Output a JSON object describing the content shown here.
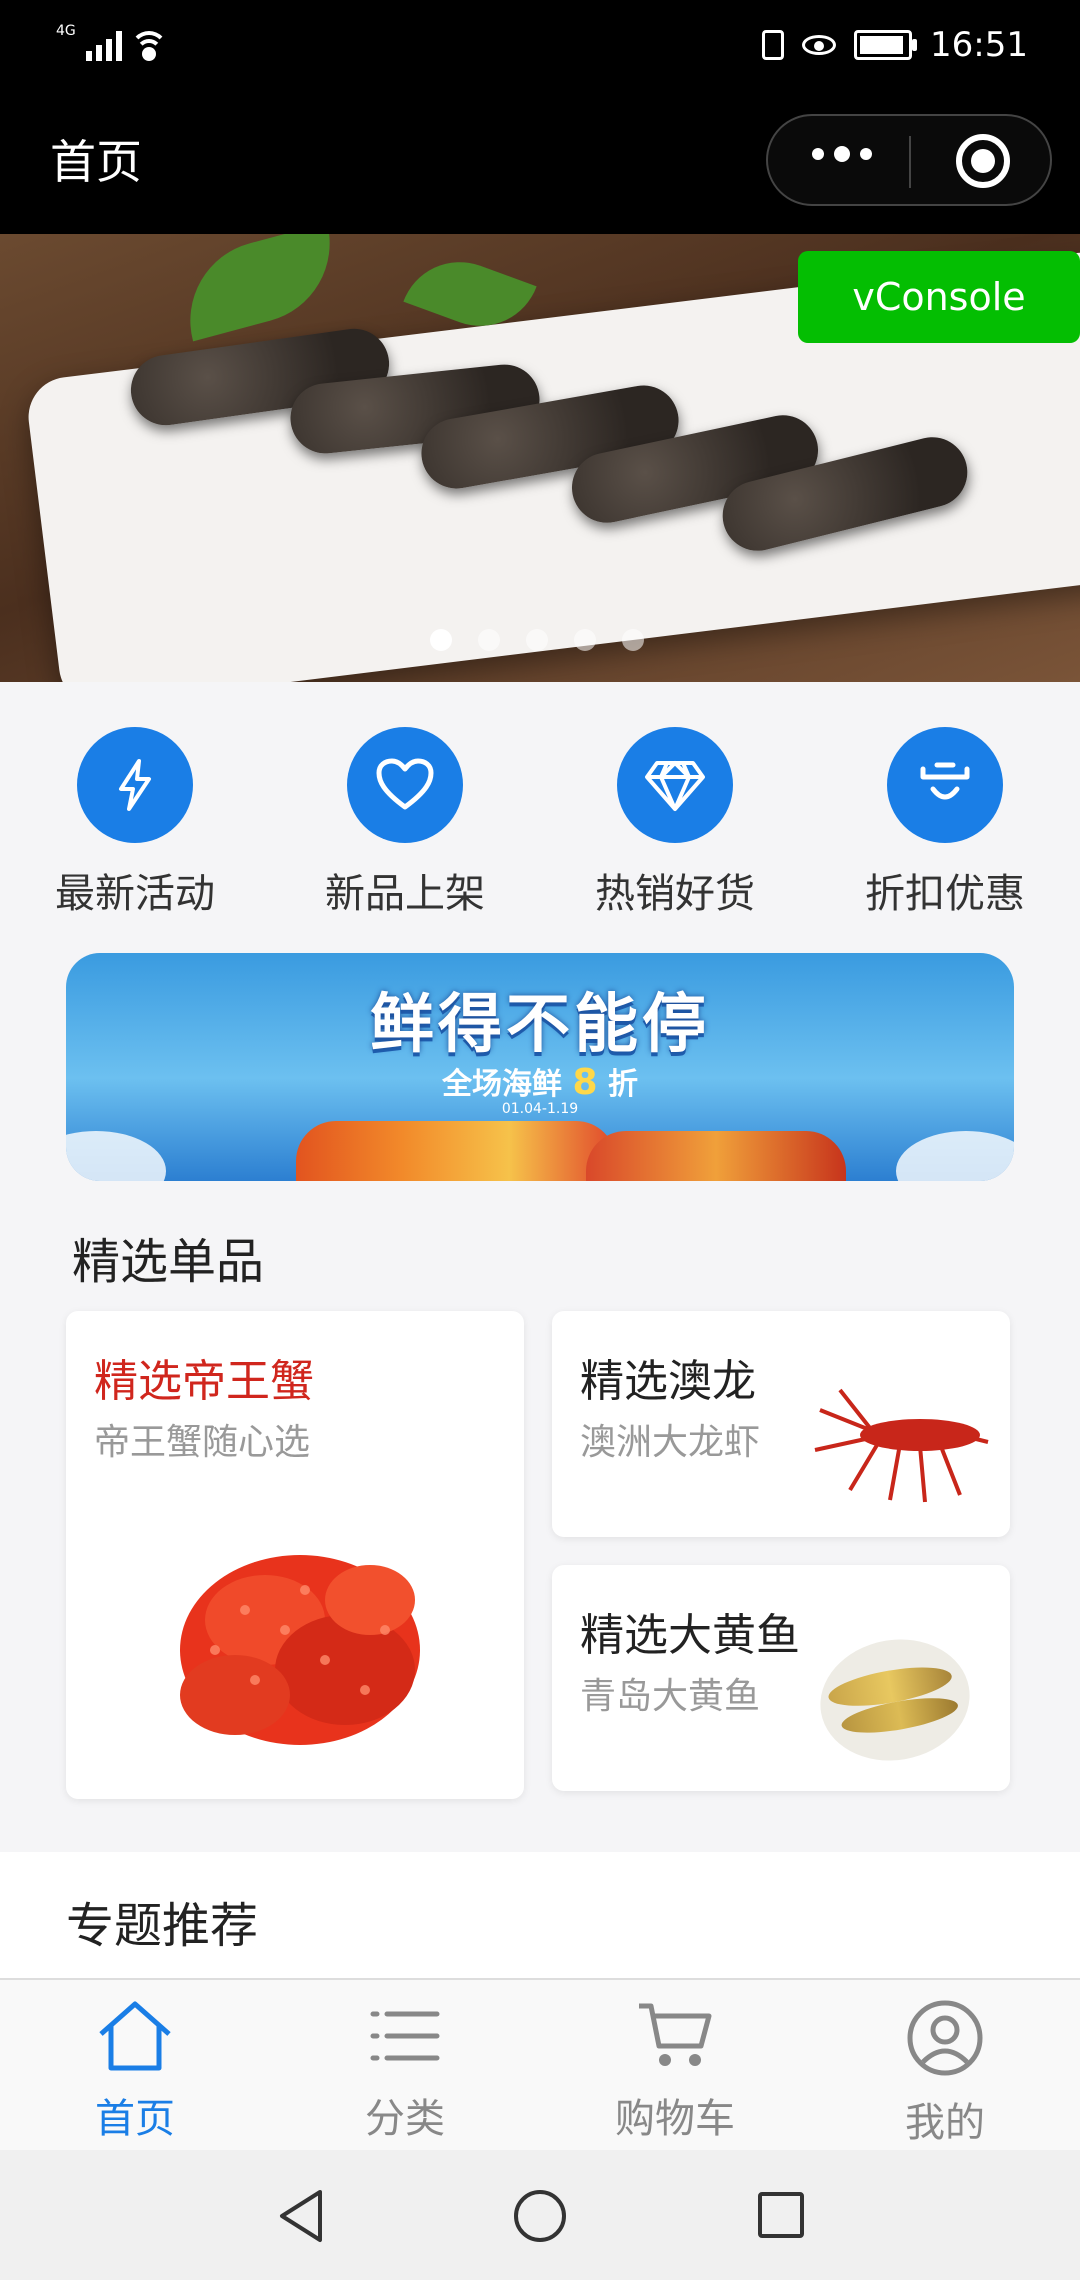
{
  "status_bar": {
    "network": "4G",
    "time": "16:51"
  },
  "navbar": {
    "title": "首页"
  },
  "banner": {
    "vconsole_label": "vConsole",
    "dots_count": 5,
    "active_dot": 0
  },
  "quick_menu": [
    {
      "label": "最新活动",
      "icon": "lightning-icon"
    },
    {
      "label": "新品上架",
      "icon": "heart-icon"
    },
    {
      "label": "热销好货",
      "icon": "diamond-icon"
    },
    {
      "label": "折扣优惠",
      "icon": "smile-icon"
    }
  ],
  "promo": {
    "title": "鲜得不能停",
    "subtitle_prefix": "全场海鲜",
    "discount": "8",
    "subtitle_suffix": "折",
    "date": "01.04-1.19"
  },
  "featured": {
    "title": "精选单品",
    "items": [
      {
        "title": "精选帝王蟹",
        "subtitle": "帝王蟹随心选"
      },
      {
        "title": "精选澳龙",
        "subtitle": "澳洲大龙虾"
      },
      {
        "title": "精选大黄鱼",
        "subtitle": "青岛大黄鱼"
      }
    ]
  },
  "topics": {
    "title": "专题推荐"
  },
  "tabbar": [
    {
      "label": "首页",
      "icon": "home-icon",
      "active": true
    },
    {
      "label": "分类",
      "icon": "list-icon",
      "active": false
    },
    {
      "label": "购物车",
      "icon": "cart-icon",
      "active": false
    },
    {
      "label": "我的",
      "icon": "user-icon",
      "active": false
    }
  ],
  "colors": {
    "accent": "#1a7ee6",
    "vconsole": "#04be02",
    "featured_red": "#d0261d"
  }
}
